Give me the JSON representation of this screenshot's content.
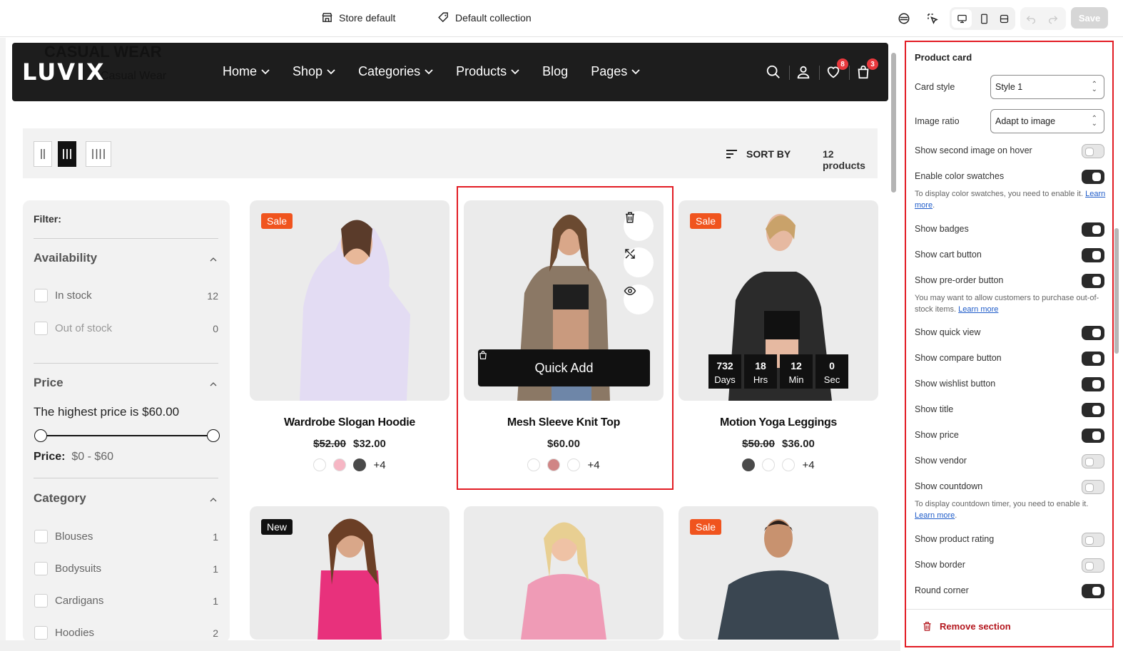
{
  "topbar": {
    "store_label": "Store default",
    "collection_label": "Default collection",
    "save_label": "Save",
    "icons": [
      "store-icon",
      "tag-icon",
      "palette-icon",
      "inspect-icon",
      "desktop-icon",
      "mobile-icon",
      "fullscreen-icon",
      "undo-icon",
      "redo-icon"
    ]
  },
  "header": {
    "logo": "LUVIX",
    "ghost_title": "CASUAL WEAR",
    "ghost_crumb": "Casual Wear",
    "nav": [
      "Home",
      "Shop",
      "Categories",
      "Products",
      "Blog",
      "Pages"
    ],
    "wishlist_count": "8",
    "cart_count": "3"
  },
  "toolbar": {
    "sort_label": "SORT BY",
    "product_count": "12 products"
  },
  "filter": {
    "title": "Filter:",
    "availability": {
      "heading": "Availability",
      "options": [
        {
          "label": "In stock",
          "count": "12"
        },
        {
          "label": "Out of stock",
          "count": "0"
        }
      ]
    },
    "price": {
      "heading": "Price",
      "note": "The highest price is $60.00",
      "label": "Price:",
      "range": "$0 - $60"
    },
    "category": {
      "heading": "Category",
      "options": [
        {
          "label": "Blouses",
          "count": "1"
        },
        {
          "label": "Bodysuits",
          "count": "1"
        },
        {
          "label": "Cardigans",
          "count": "1"
        },
        {
          "label": "Hoodies",
          "count": "2"
        }
      ]
    }
  },
  "products": [
    {
      "title": "Wardrobe Slogan Hoodie",
      "old_price": "$52.00",
      "price": "$32.00",
      "badge": "Sale",
      "more": "+4",
      "swatches": [
        "#ffffff",
        "#f6b6c4",
        "#4a4a4a"
      ]
    },
    {
      "title": "Mesh Sleeve Knit Top",
      "old_price": "",
      "price": "$60.00",
      "badge": "",
      "more": "+4",
      "quick_add": "Quick Add",
      "swatches": [
        "#ffffff",
        "#d08585",
        "#ffffff"
      ]
    },
    {
      "title": "Motion Yoga Leggings",
      "old_price": "$50.00",
      "price": "$36.00",
      "badge": "Sale",
      "more": "+4",
      "swatches": [
        "#4a4a4a",
        "#ffffff",
        "#ffffff"
      ],
      "countdown": [
        {
          "value": "732",
          "unit": "Days"
        },
        {
          "value": "18",
          "unit": "Hrs"
        },
        {
          "value": "12",
          "unit": "Min"
        },
        {
          "value": "0",
          "unit": "Sec"
        }
      ]
    },
    {
      "badge": "New"
    },
    {
      "badge": ""
    },
    {
      "badge": "Sale"
    }
  ],
  "panel": {
    "title": "Product card",
    "card_style_label": "Card style",
    "card_style_value": "Style 1",
    "image_ratio_label": "Image ratio",
    "image_ratio_value": "Adapt to image",
    "settings": [
      {
        "label": "Show second image on hover",
        "on": false
      },
      {
        "label": "Enable color swatches",
        "on": true,
        "help": "To display color swatches, you need to enable it.",
        "link": "Learn more"
      },
      {
        "label": "Show badges",
        "on": true
      },
      {
        "label": "Show cart button",
        "on": true
      },
      {
        "label": "Show pre-order button",
        "on": true,
        "help": "You may want to allow customers to purchase out-of-stock items.",
        "link": "Learn more"
      },
      {
        "label": "Show quick view",
        "on": true
      },
      {
        "label": "Show compare button",
        "on": true
      },
      {
        "label": "Show wishlist button",
        "on": true
      },
      {
        "label": "Show title",
        "on": true
      },
      {
        "label": "Show price",
        "on": true
      },
      {
        "label": "Show vendor",
        "on": false
      },
      {
        "label": "Show countdown",
        "on": false,
        "help": "To display countdown timer, you need to enable it.",
        "link": "Learn more"
      },
      {
        "label": "Show product rating",
        "on": false
      },
      {
        "label": "Show border",
        "on": false
      },
      {
        "label": "Round corner",
        "on": true
      }
    ],
    "remove_label": "Remove section"
  },
  "colors": {
    "accent_red": "#e21c24",
    "sale": "#f0541e",
    "dark": "#1d1d1d"
  }
}
